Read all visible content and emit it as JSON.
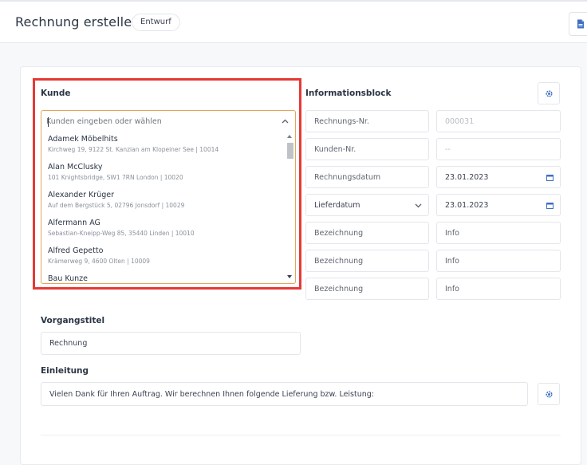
{
  "header": {
    "title": "Rechnung erstellen",
    "status": "Entwurf",
    "action_icon": "document-icon"
  },
  "customer": {
    "label": "Kunde",
    "placeholder": "Kunden eingeben oder wählen",
    "options": [
      {
        "name": "Adamek Möbelhits",
        "detail": "Kirchweg 19, 9122 St. Kanzian am Klopeiner See | 10014"
      },
      {
        "name": "Alan McClusky",
        "detail": "101 Knightsbridge, SW1 7RN London | 10020"
      },
      {
        "name": "Alexander Krüger",
        "detail": "Auf dem Bergstück 5, 02796 Jonsdorf | 10029"
      },
      {
        "name": "Alfermann AG",
        "detail": "Sebastian-Kneipp-Weg 85, 35440 Linden | 10010"
      },
      {
        "name": "Alfred Gepetto",
        "detail": "Krämerweg 9, 4600 Olten | 10009"
      },
      {
        "name": "Bau Kunze",
        "detail": ""
      }
    ]
  },
  "info_block": {
    "label": "Informationsblock",
    "rows": [
      {
        "label": "Rechnungs-Nr.",
        "value": "000031"
      },
      {
        "label": "Kunden-Nr.",
        "value": "--"
      },
      {
        "label": "Rechnungsdatum",
        "value": "23.01.2023"
      },
      {
        "label": "Lieferdatum",
        "value": "23.01.2023"
      },
      {
        "label": "Bezeichnung",
        "value": "Info"
      },
      {
        "label": "Bezeichnung",
        "value": "Info"
      },
      {
        "label": "Bezeichnung",
        "value": "Info"
      }
    ]
  },
  "title_section": {
    "label": "Vorgangstitel",
    "value": "Rechnung"
  },
  "intro_section": {
    "label": "Einleitung",
    "value": "Vielen Dank für Ihren Auftrag. Wir berechnen Ihnen folgende Lieferung bzw. Leistung:"
  },
  "colors": {
    "highlight": "#e53935",
    "accent": "#3d6fc4",
    "focus_border": "#e2a65a"
  }
}
